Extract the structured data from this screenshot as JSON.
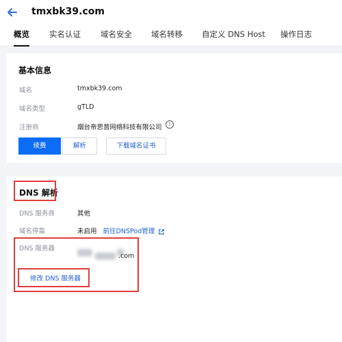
{
  "header": {
    "back_icon": "arrow-left-icon",
    "domain_title": "tmxbk39.com",
    "tabs": [
      "概览",
      "实名认证",
      "域名安全",
      "域名转移",
      "自定义 DNS Host",
      "操作日志"
    ],
    "active_tab": "概览"
  },
  "basic_info": {
    "title": "基本信息",
    "rows": [
      {
        "label": "域名",
        "value": "tmxbk39.com"
      },
      {
        "label": "域名类型",
        "value": "gTLD"
      },
      {
        "label": "注册商",
        "value": "烟台帝思普网络科技有限公司"
      }
    ],
    "info_icon": "info-circle-icon",
    "info_glyph": "i",
    "buttons": {
      "renew": "续费",
      "resolve": "解析",
      "download_cert": "下载域名证书"
    }
  },
  "dns": {
    "title": "DNS 解析",
    "provider_label": "DNS 服务商",
    "provider_value": "其他",
    "parking_label": "域名停靠",
    "parking_value": "未启用",
    "parking_link": "前往DNSPod管理",
    "external_link_icon": "external-link-icon",
    "servers_label": "DNS 服务器",
    "server_value_visible": ".com",
    "modify_button": "修改 DNS 服务器"
  },
  "colors": {
    "primary": "#0b6cf5",
    "link": "#1e5fd6",
    "highlight_box": "#e23b3b",
    "background": "#f3f4f7"
  }
}
